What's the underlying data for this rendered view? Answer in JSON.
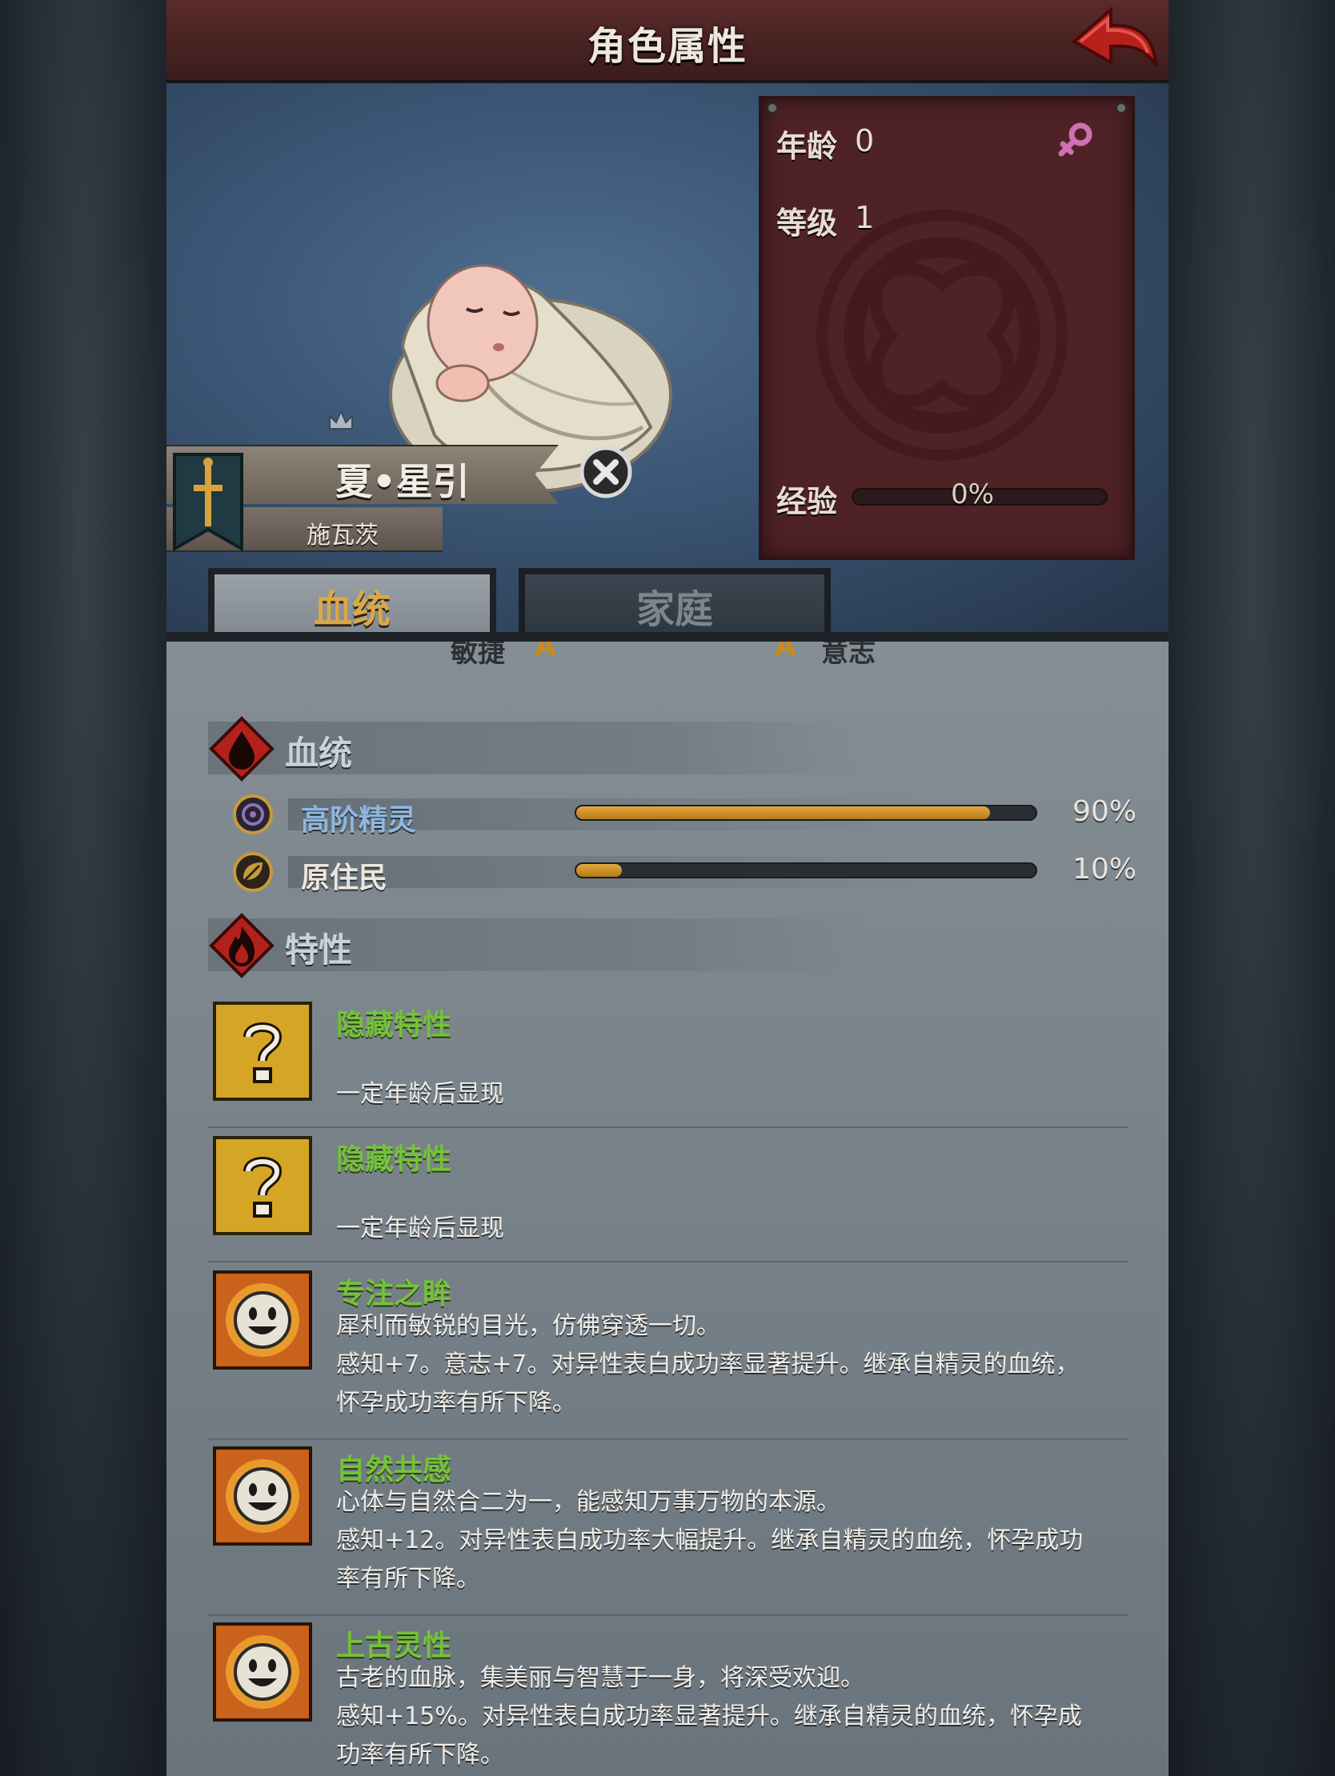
{
  "header": {
    "title": "角色属性"
  },
  "character": {
    "name": "夏•星引",
    "house": "施瓦茨"
  },
  "stats": {
    "age_label": "年龄",
    "age_value": "0",
    "level_label": "等级",
    "level_value": "1",
    "exp_label": "经验",
    "exp_value": "0%",
    "exp_fraction": 0
  },
  "tabs": [
    {
      "label": "血统",
      "active": true
    },
    {
      "label": "家庭",
      "active": false
    }
  ],
  "attributes_partial": {
    "left_label": "敏捷",
    "left_grade": "A",
    "right_grade": "A",
    "right_label": "意志"
  },
  "bloodline": {
    "section_title": "血统",
    "items": [
      {
        "label": "高阶精灵",
        "percent": "90%",
        "fraction": 0.9,
        "color": "#8fb7e0"
      },
      {
        "label": "原住民",
        "percent": "10%",
        "fraction": 0.1,
        "color": "#ece6de"
      }
    ]
  },
  "traits": {
    "section_title": "特性",
    "items": [
      {
        "name": "隐藏特性",
        "desc": [
          "一定年龄后显现"
        ],
        "icon": "question-icon"
      },
      {
        "name": "隐藏特性",
        "desc": [
          "一定年龄后显现"
        ],
        "icon": "question-icon"
      },
      {
        "name": "专注之眸",
        "desc": [
          "犀利而敏锐的目光，仿佛穿透一切。",
          "感知+7。意志+7。对异性表白成功率显著提升。继承自精灵的血统，",
          "怀孕成功率有所下降。"
        ],
        "icon": "smiley-icon"
      },
      {
        "name": "自然共感",
        "desc": [
          "心体与自然合二为一，能感知万事万物的本源。",
          "感知+12。对异性表白成功率大幅提升。继承自精灵的血统，怀孕成功",
          "率有所下降。"
        ],
        "icon": "smiley-icon"
      },
      {
        "name": "上古灵性",
        "desc": [
          "古老的血脉，集美丽与智慧于一身，将深受欢迎。",
          "感知+15%。对异性表白成功率显著提升。继承自精灵的血统，怀孕成",
          "功率有所下降。"
        ],
        "icon": "smiley-icon"
      }
    ]
  },
  "colors": {
    "trait_name": "#75c23a",
    "bar_fill": "#e3a83c",
    "gender_icon": "#d06fb4"
  }
}
